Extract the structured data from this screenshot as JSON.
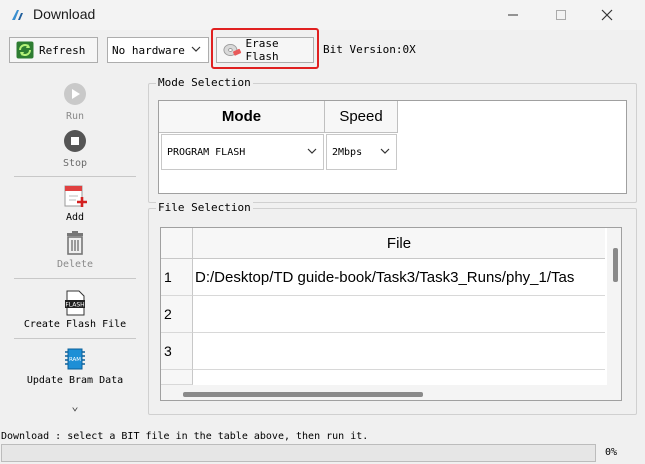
{
  "window": {
    "title": "Download",
    "minimize": "—",
    "maximize": "☐",
    "close": "✕"
  },
  "toolbar": {
    "refresh_label": "Refresh",
    "hardware_value": "No hardware",
    "erase_label": "Erase Flash",
    "bit_version": "Bit Version:0X"
  },
  "sidebar": {
    "run": "Run",
    "stop": "Stop",
    "add": "Add",
    "delete": "Delete",
    "create_flash": "Create Flash File",
    "update_bram": "Update Bram Data",
    "flash_icon_text": "FLASH",
    "ram_icon_text": "RAM",
    "more": "⌄"
  },
  "mode_selection": {
    "title": "Mode Selection",
    "col_mode": "Mode",
    "col_speed": "Speed",
    "mode_value": "PROGRAM FLASH",
    "speed_value": "2Mbps"
  },
  "file_selection": {
    "title": "File Selection",
    "col_file": "File",
    "rows": [
      {
        "num": "1",
        "file": "D:/Desktop/TD guide-book/Task3/Task3_Runs/phy_1/Tas"
      },
      {
        "num": "2",
        "file": ""
      },
      {
        "num": "3",
        "file": ""
      }
    ]
  },
  "status": {
    "message": "Download : select a BIT file in the table above, then run it.",
    "progress_percent": 0,
    "progress_label": "0%"
  }
}
